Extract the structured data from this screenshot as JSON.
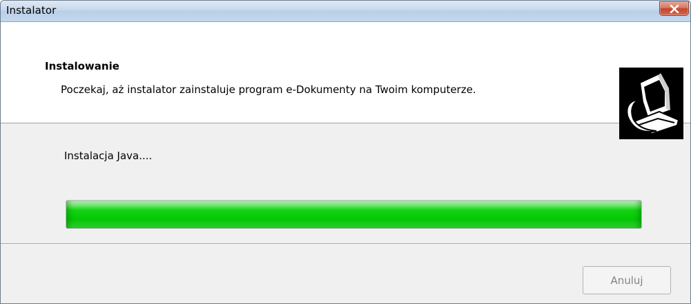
{
  "window": {
    "title": "Instalator"
  },
  "header": {
    "title": "Instalowanie",
    "subtitle": "Poczekaj, aż instalator zainstaluje program e-Dokumenty na Twoim komputerze.",
    "icon": "computer-install-icon"
  },
  "status": {
    "text": "Instalacja Java....",
    "progress": 1.0
  },
  "buttons": {
    "cancel_label": "Anuluj",
    "cancel_enabled": false,
    "close_icon": "close-icon"
  },
  "colors": {
    "progress_fill": "#0ccc0c",
    "close_button": "#c8503a",
    "icon_background": "#000000"
  }
}
